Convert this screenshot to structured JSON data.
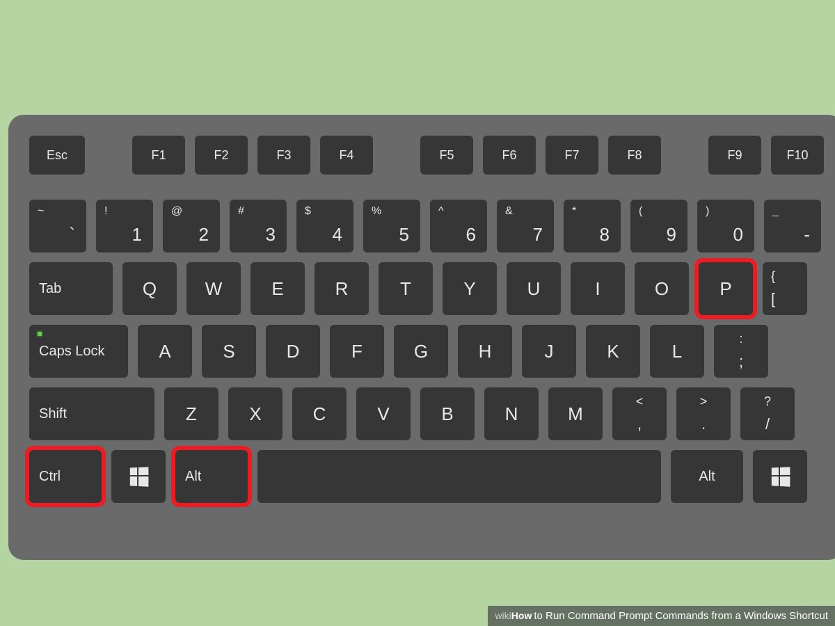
{
  "caption": {
    "brand1": "wiki",
    "brand2": "How",
    "text": " to Run Command Prompt Commands from a Windows Shortcut"
  },
  "keys": {
    "esc": "Esc",
    "fn": [
      "F1",
      "F2",
      "F3",
      "F4",
      "F5",
      "F6",
      "F7",
      "F8",
      "F9",
      "F10"
    ],
    "numRow": [
      {
        "t": "~",
        "b": "`"
      },
      {
        "t": "!",
        "b": "1"
      },
      {
        "t": "@",
        "b": "2"
      },
      {
        "t": "#",
        "b": "3"
      },
      {
        "t": "$",
        "b": "4"
      },
      {
        "t": "%",
        "b": "5"
      },
      {
        "t": "^",
        "b": "6"
      },
      {
        "t": "&",
        "b": "7"
      },
      {
        "t": "*",
        "b": "8"
      },
      {
        "t": "(",
        "b": "9"
      },
      {
        "t": ")",
        "b": "0"
      },
      {
        "t": "_",
        "b": "-"
      }
    ],
    "tab": "Tab",
    "qrow": [
      "Q",
      "W",
      "E",
      "R",
      "T",
      "Y",
      "U",
      "I",
      "O",
      "P"
    ],
    "bracket": {
      "t": "{",
      "b": "["
    },
    "caps": "Caps Lock",
    "arow": [
      "A",
      "S",
      "D",
      "F",
      "G",
      "H",
      "J",
      "K",
      "L"
    ],
    "semi": {
      "t": ":",
      "b": ";"
    },
    "shift": "Shift",
    "zrow": [
      "Z",
      "X",
      "C",
      "V",
      "B",
      "N",
      "M"
    ],
    "comma": {
      "t": "<",
      "b": ","
    },
    "period": {
      "t": ">",
      "b": "."
    },
    "slash": {
      "t": "?",
      "b": "/"
    },
    "ctrl": "Ctrl",
    "alt": "Alt",
    "altR": "Alt"
  },
  "highlighted": [
    "ctrl-key",
    "alt-key",
    "p-key"
  ]
}
